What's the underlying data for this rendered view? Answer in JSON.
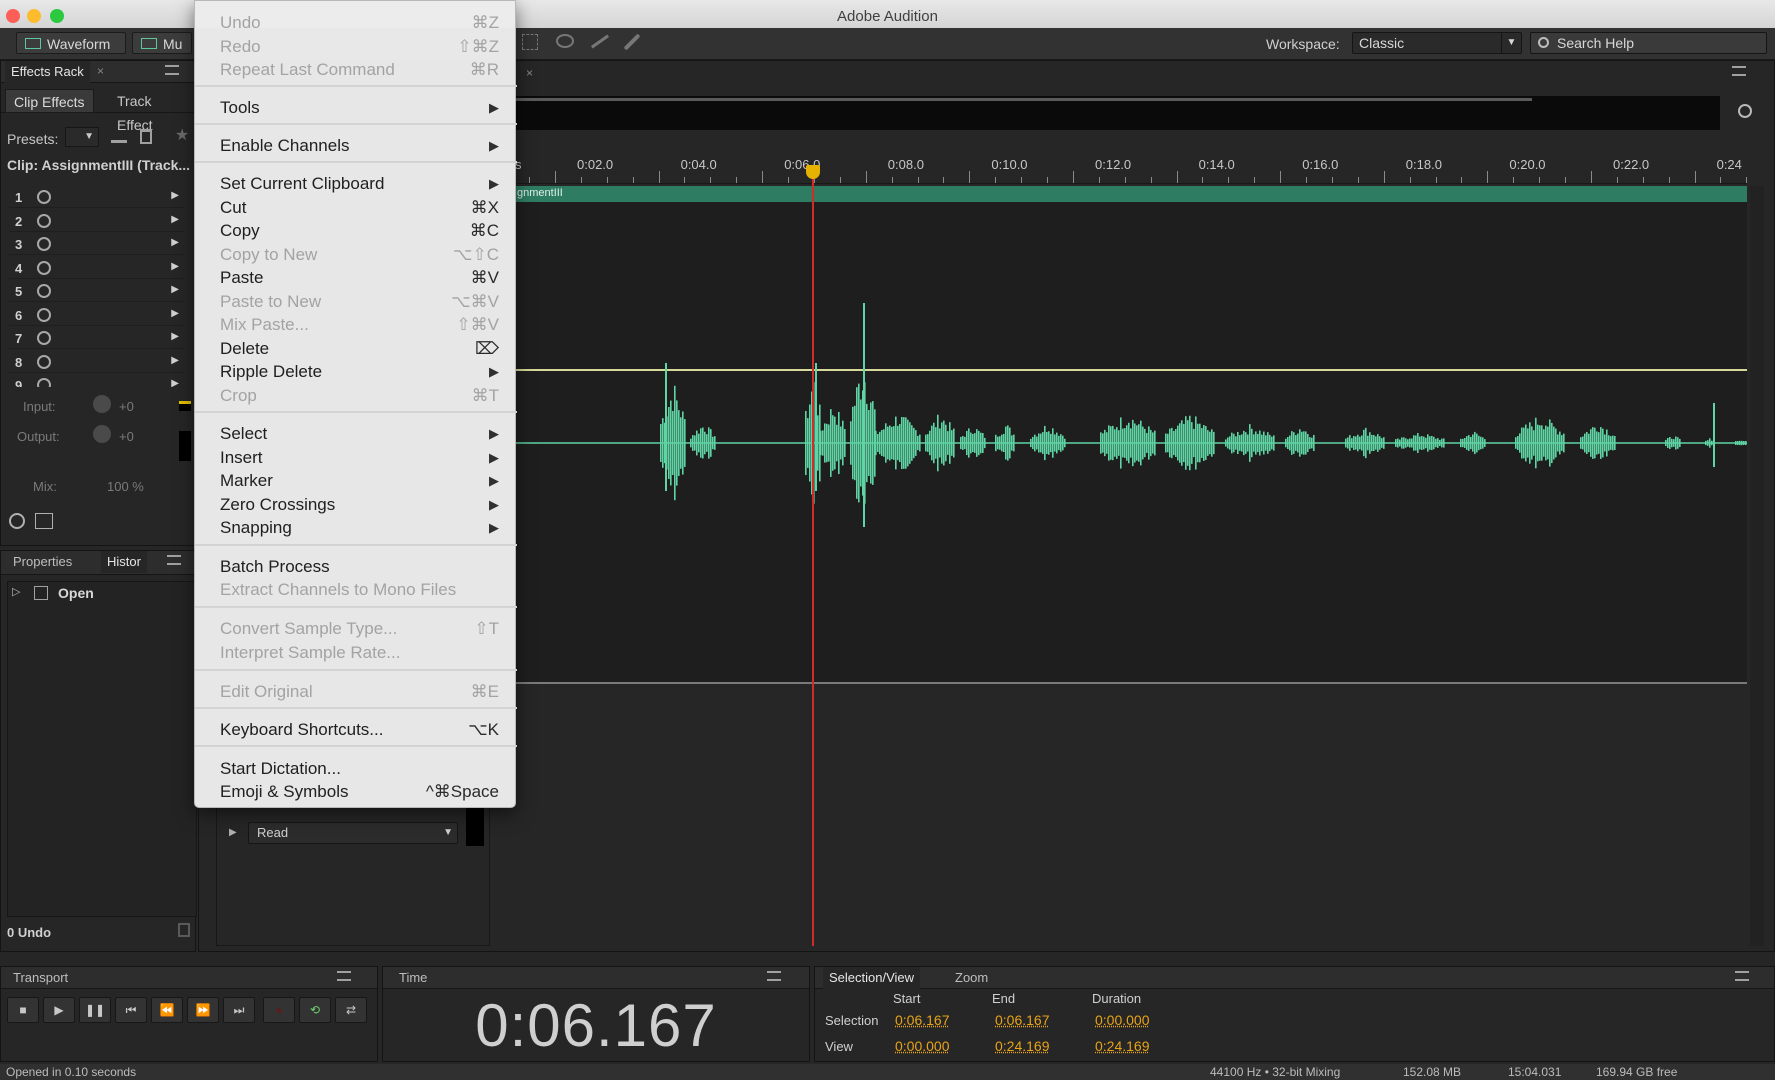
{
  "window": {
    "title": "Adobe Audition"
  },
  "toolbar": {
    "waveform_label": "Waveform",
    "multitrack_label": "Mu",
    "workspace_label": "Workspace:",
    "workspace_value": "Classic",
    "search_placeholder": "Search Help"
  },
  "effects_rack": {
    "tab_label": "Effects Rack",
    "clip_effects_label": "Clip Effects",
    "track_effects_label": "Track Effect",
    "presets_label": "Presets:",
    "clip_label": "Clip: AssignmentIII (Track...",
    "slots": [
      "1",
      "2",
      "3",
      "4",
      "5",
      "6",
      "7",
      "8",
      "9"
    ],
    "input_label": "Input:",
    "input_value": "+0",
    "output_label": "Output:",
    "output_value": "+0",
    "mix_label": "Mix:",
    "mix_value": "100 %"
  },
  "history": {
    "properties_tab": "Properties",
    "history_tab": "Histor",
    "items": [
      "Open"
    ],
    "undo_count": "0 Undo"
  },
  "editor": {
    "clip_name": "gnmentIII",
    "ruler_partial": "s",
    "ruler_labels": [
      "0:02.0",
      "0:04.0",
      "0:06.0",
      "0:08.0",
      "0:10.0",
      "0:12.0",
      "0:14.0",
      "0:16.0",
      "0:18.0",
      "0:20.0",
      "0:22.0",
      "0:24"
    ],
    "read_mode": "Read",
    "waveform_color": "#5fd4a4",
    "playhead_color": "#d12b2b"
  },
  "edit_menu": {
    "items": [
      {
        "label": "Undo",
        "shortcut": "⌘Z",
        "disabled": true
      },
      {
        "label": "Redo",
        "shortcut": "⇧⌘Z",
        "disabled": true
      },
      {
        "label": "Repeat Last Command",
        "shortcut": "⌘R",
        "disabled": true
      },
      {
        "label": "Tools",
        "submenu": true
      },
      {
        "label": "Enable Channels",
        "submenu": true
      },
      {
        "label": "Set Current Clipboard",
        "submenu": true
      },
      {
        "label": "Cut",
        "shortcut": "⌘X"
      },
      {
        "label": "Copy",
        "shortcut": "⌘C"
      },
      {
        "label": "Copy to New",
        "shortcut": "⌥⇧C",
        "disabled": true
      },
      {
        "label": "Paste",
        "shortcut": "⌘V"
      },
      {
        "label": "Paste to New",
        "shortcut": "⌥⌘V",
        "disabled": true
      },
      {
        "label": "Mix Paste...",
        "shortcut": "⇧⌘V",
        "disabled": true
      },
      {
        "label": "Delete",
        "shortcut": "⌦"
      },
      {
        "label": "Ripple Delete",
        "submenu": true
      },
      {
        "label": "Crop",
        "shortcut": "⌘T",
        "disabled": true
      },
      {
        "label": "Select",
        "submenu": true
      },
      {
        "label": "Insert",
        "submenu": true
      },
      {
        "label": "Marker",
        "submenu": true
      },
      {
        "label": "Zero Crossings",
        "submenu": true
      },
      {
        "label": "Snapping",
        "submenu": true
      },
      {
        "label": "Batch Process"
      },
      {
        "label": "Extract Channels to Mono Files",
        "disabled": true
      },
      {
        "label": "Convert Sample Type...",
        "shortcut": "⇧T",
        "disabled": true
      },
      {
        "label": "Interpret Sample Rate...",
        "disabled": true
      },
      {
        "label": "Edit Original",
        "shortcut": "⌘E",
        "disabled": true
      },
      {
        "label": "Keyboard Shortcuts...",
        "shortcut": "⌥K"
      },
      {
        "label": "Start Dictation..."
      },
      {
        "label": "Emoji & Symbols",
        "shortcut": "^⌘Space"
      }
    ]
  },
  "transport": {
    "tab_label": "Transport"
  },
  "time": {
    "tab_label": "Time",
    "value": "0:06.167"
  },
  "selection_view": {
    "tab_label": "Selection/View",
    "zoom_tab": "Zoom",
    "col_start": "Start",
    "col_end": "End",
    "col_duration": "Duration",
    "selection_label": "Selection",
    "selection_start": "0:06.167",
    "selection_end": "0:06.167",
    "selection_duration": "0:00.000",
    "view_label": "View",
    "view_start": "0:00.000",
    "view_end": "0:24.169",
    "view_duration": "0:24.169"
  },
  "status": {
    "message": "Opened in 0.10 seconds",
    "format": "44100 Hz • 32-bit Mixing",
    "memory": "152.08 MB",
    "duration": "15:04.031",
    "free_space": "169.94 GB free"
  }
}
